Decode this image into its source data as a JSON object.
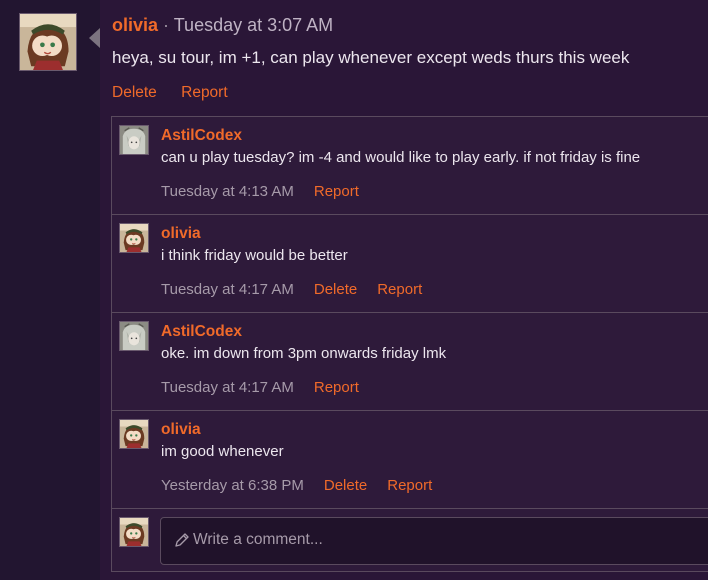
{
  "post": {
    "author": "olivia",
    "separator": "·",
    "timestamp": "Tuesday at 3:07 AM",
    "body": "heya, su tour, im +1, can play whenever except weds thurs this week",
    "actions": {
      "delete": "Delete",
      "report": "Report"
    }
  },
  "comments": [
    {
      "author": "AstilCodex",
      "text": "can u play tuesday? im -4 and would like to play early. if not friday is fine",
      "timestamp": "Tuesday at 4:13 AM",
      "report": "Report"
    },
    {
      "author": "olivia",
      "text": "i think friday would be better",
      "timestamp": "Tuesday at 4:17 AM",
      "delete": "Delete",
      "report": "Report"
    },
    {
      "author": "AstilCodex",
      "text": "oke. im down from 3pm onwards friday lmk",
      "timestamp": "Tuesday at 4:17 AM",
      "report": "Report"
    },
    {
      "author": "olivia",
      "text": "im good whenever",
      "timestamp": "Yesterday at 6:38 PM",
      "delete": "Delete",
      "report": "Report"
    }
  ],
  "composer": {
    "placeholder": "Write a comment..."
  },
  "icons": {
    "composer": "pencil-icon"
  },
  "colors": {
    "accent": "#f06a2a",
    "background": "#2a1637",
    "text": "#ece6ee",
    "muted": "#a69aa9"
  }
}
